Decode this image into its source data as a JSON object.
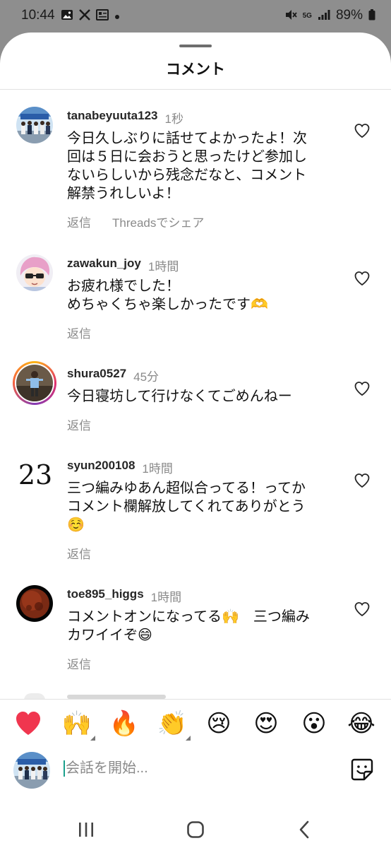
{
  "status_bar": {
    "time": "10:44",
    "battery": "89%",
    "network": "5G"
  },
  "sheet": {
    "title": "コメント"
  },
  "comments": [
    {
      "username": "tanabeyuuta123",
      "time": "1秒",
      "text_lines": [
        "今日久しぶりに話せてよかったよ！次",
        "回は５日に会おうと思ったけど参加し",
        "ないらしいから残念だなと、コメント",
        "解禁うれしいよ！"
      ],
      "reply": "返信",
      "share": "Threadsでシェア",
      "avatar": "group-photo"
    },
    {
      "username": "zawakun_joy",
      "time": "1時間",
      "text_lines": [
        "お疲れ様でした！",
        "めちゃくちゃ楽しかったです🫶"
      ],
      "reply": "返信",
      "avatar": "anime-character"
    },
    {
      "username": "shura0527",
      "time": "45分",
      "text_lines": [
        "今日寝坊して行けなくてごめんねー"
      ],
      "reply": "返信",
      "avatar": "person-with-story-ring"
    },
    {
      "username": "syun200108",
      "time": "1時間",
      "avatar_text": "23",
      "text_lines": [
        "三つ編みゆあん超似合ってる！ってか",
        "コメント欄解放してくれてありがとう",
        "☺️"
      ],
      "reply": "返信"
    },
    {
      "username": "toe895_higgs",
      "time": "1時間",
      "text_lines": [
        "コメントオンになってる🙌　三つ編み",
        "カワイイぞ😄"
      ],
      "reply": "返信",
      "avatar": "red-moon"
    }
  ],
  "emoji_bar": [
    "❤️",
    "🙌",
    "🔥",
    "👏",
    "😢",
    "😍",
    "😮",
    "😂"
  ],
  "composer": {
    "placeholder": "会話を開始..."
  },
  "colors": {
    "sheet_bg": "#ffffff",
    "backdrop": "#8e8e8e",
    "secondary_text": "#8a8a8a",
    "cursor": "#1aa08c"
  }
}
